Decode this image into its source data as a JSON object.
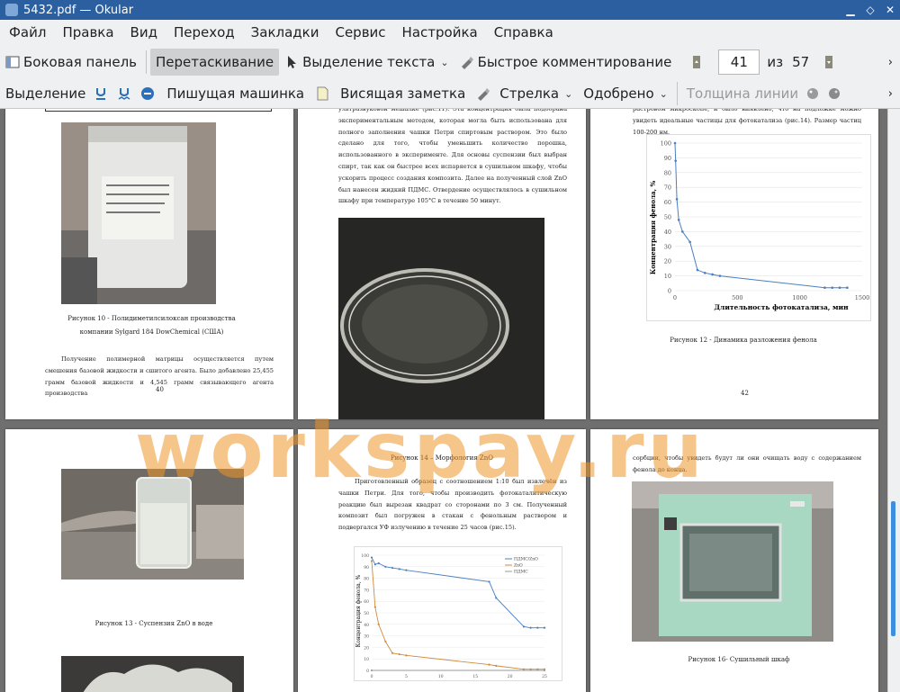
{
  "window": {
    "title": "5432.pdf  — Okular"
  },
  "menu": [
    "Файл",
    "Правка",
    "Вид",
    "Переход",
    "Закладки",
    "Сервис",
    "Настройка",
    "Справка"
  ],
  "toolbar1": {
    "sidebar": "Боковая панель",
    "drag": "Перетаскивание",
    "select_text": "Выделение текста",
    "quick_comment": "Быстрое комментирование",
    "page_current": "41",
    "page_of": "из",
    "page_total": "57"
  },
  "toolbar2": {
    "selection": "Выделение",
    "typewriter": "Пишущая машинка",
    "sticky_note": "Висящая заметка",
    "arrow": "Стрелка",
    "approved": "Одобрено",
    "line_width": "Толщина линии"
  },
  "pages": {
    "p40": {
      "caption": "Рисунок 10 - Полидиметилсилоксан производства компании Sylgard 184 DowChemical (США)",
      "text": "Получение полимерной матрицы осуществляется путем смешения базовой жидкости и сшитого агента. Было добавлено 25,455 грамм базовой жидкости и 4,545 грамм связывающего агента производства",
      "number": "40"
    },
    "p41": {
      "text": "ультразвуковой мешалке (рис.11). Эта концентрация была подобрана экспериментальным методом, которая могла быть использована для полного заполнения чашки Петри спиртовым раствором. Это было сделано для того, чтобы уменьшить количество порошка, использованного в эксперименте. Для основы суспензии был выбран спирт, так как он быстрее всех испаряется в сушильном шкафу, чтобы ускорить процесс создания композита. Далее на полученный слой ZnO был нанесен жидкий ПДМС. Отвердение осуществлялось в сушильном шкафу при температуре 105°С в течение 50 минут."
    },
    "p42": {
      "text": "растровом микроскопе, и было выявлено, что на подложке можно увидеть идеальные частицы для фотокатализа (рис.14). Размер частиц 100-200 нм.",
      "caption": "Рисунок 12 - Динамика разложения фенола",
      "number": "42"
    },
    "p43": {
      "caption": "Рисунок 13 - Суспензия ZnO в воде"
    },
    "p44": {
      "caption_top": "Рисунок 14 – Морфология ZnO",
      "text": "Приготовленный образец с соотношением 1:10 был извлечён из чашки Петри. Для того, чтобы производить фотокаталитическую реакцию был вырезан квадрат со сторонами по 3 см. Полученный композит был погружен в стакан с фенольным раствором и подвергался УФ излучению в течение 25 часов (рис.15)."
    },
    "p45": {
      "text": "сорбции, чтобы увидеть будут ли они очищать воду с содержанием фенола до конца.",
      "caption": "Рисунок 16- Сушильный шкаф"
    }
  },
  "chart_data": [
    {
      "type": "line",
      "title": "",
      "xlabel": "Длительность фотокатализа, мин",
      "ylabel": "Концентрация фенола, %",
      "xlim": [
        0,
        1500
      ],
      "ylim": [
        0,
        100
      ],
      "xticks": [
        "0",
        "500",
        "1000",
        "1500"
      ],
      "yticks": [
        "0",
        "10",
        "20",
        "30",
        "40",
        "50",
        "60",
        "70",
        "80",
        "90",
        "100"
      ],
      "series": [
        {
          "color": "#4a7fc0",
          "x": [
            0,
            5,
            15,
            30,
            60,
            120,
            180,
            240,
            300,
            360,
            1200,
            1260,
            1320,
            1380
          ],
          "y": [
            100,
            88,
            62,
            48,
            40,
            33,
            14,
            12,
            11,
            10,
            2,
            2,
            2,
            2
          ]
        }
      ]
    },
    {
      "type": "line",
      "xlabel": "",
      "ylabel": "Концентрация фенола, %",
      "xlim": [
        0,
        25
      ],
      "ylim": [
        0,
        100
      ],
      "yticks": [
        "0",
        "10",
        "20",
        "30",
        "40",
        "50",
        "60",
        "70",
        "80",
        "90",
        "100"
      ],
      "xticks": [
        "0",
        "5",
        "10",
        "15",
        "20",
        "25"
      ],
      "legend": [
        "ПДМС/ZnO",
        "ZnO",
        "ПДМС"
      ],
      "series": [
        {
          "name": "ПДМС/ZnO",
          "color": "#4a7fc0",
          "x": [
            0,
            0.5,
            1,
            2,
            3,
            4,
            5,
            17,
            18,
            22,
            23,
            24,
            25
          ],
          "y": [
            98,
            92,
            93,
            90,
            89,
            88,
            87,
            77,
            63,
            38,
            37,
            37,
            37
          ]
        },
        {
          "name": "ZnO",
          "color": "#d08a3c",
          "x": [
            0,
            0.5,
            1,
            2,
            3,
            4,
            5,
            17,
            18,
            22,
            23,
            24,
            25
          ],
          "y": [
            95,
            55,
            40,
            25,
            15,
            14,
            13,
            5,
            4,
            1,
            1,
            1,
            1
          ]
        },
        {
          "name": "ПДМС",
          "color": "#9a9a9a",
          "x": [
            0,
            25
          ],
          "y": [
            0,
            0
          ]
        }
      ]
    }
  ]
}
